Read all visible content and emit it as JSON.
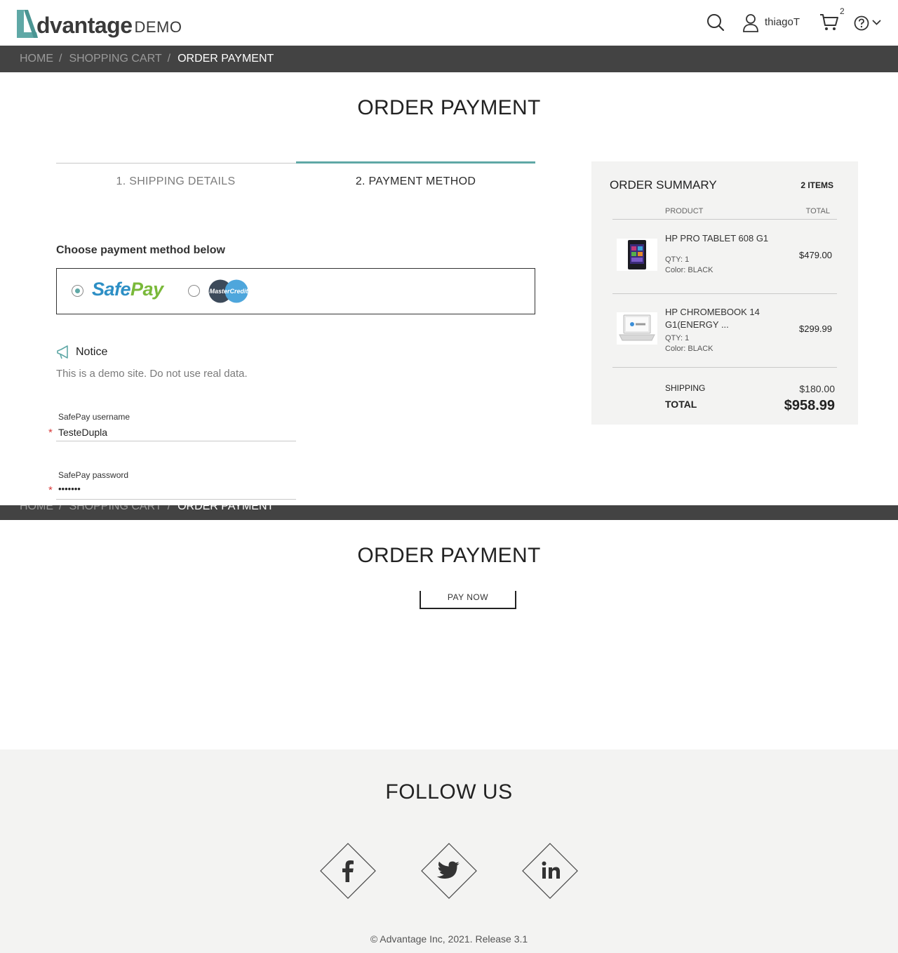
{
  "header": {
    "logo_word": "dvantage",
    "logo_demo": "DEMO",
    "user_name": "thiagoT",
    "cart_count": "2",
    "icons": [
      "search-icon",
      "user-icon",
      "cart-icon",
      "help-icon",
      "chevron-down-icon"
    ]
  },
  "breadcrumb": {
    "home": "HOME",
    "sep": "/",
    "cart": "SHOPPING CART",
    "current": "ORDER PAYMENT"
  },
  "page_title": "ORDER PAYMENT",
  "steps": [
    {
      "label": "1. SHIPPING DETAILS",
      "active": false
    },
    {
      "label": "2. PAYMENT METHOD",
      "active": true
    }
  ],
  "payment": {
    "choose_label": "Choose payment method below",
    "options": [
      {
        "name": "SafePay",
        "selected": true
      },
      {
        "name": "MasterCredit",
        "selected": false
      }
    ],
    "safepay_part1": "Safe",
    "safepay_part2": "Pay",
    "mastercredit_text": "MasterCredit"
  },
  "notice": {
    "title": "Notice",
    "text": "This is a demo site. Do not use real data."
  },
  "fields": {
    "username_label": "SafePay username",
    "username_value": "TesteDupla",
    "password_label": "SafePay password",
    "password_value": "•••••••",
    "required_mark": "*"
  },
  "summary": {
    "title": "ORDER SUMMARY",
    "items_count": "2 ITEMS",
    "col_product": "PRODUCT",
    "col_total": "TOTAL",
    "products": [
      {
        "name": "HP PRO TABLET 608 G1",
        "qty": "QTY: 1",
        "color": "Color: BLACK",
        "price": "$479.00"
      },
      {
        "name": "HP CHROMEBOOK 14 G1(ENERGY ...",
        "qty": "QTY: 1",
        "color": "Color: BLACK",
        "price": "$299.99"
      }
    ],
    "shipping_label": "SHIPPING",
    "shipping_value": "$180.00",
    "total_label": "TOTAL",
    "total_value": "$958.99"
  },
  "pay_now": "PAY NOW",
  "footer": {
    "follow": "FOLLOW US",
    "social": [
      "facebook-icon",
      "twitter-icon",
      "linkedin-icon"
    ],
    "copyright": "© Advantage Inc, 2021. Release 3.1"
  },
  "colors": {
    "accent": "#5fa8a6",
    "breadcrumb_bg": "#434343",
    "summary_bg": "#f3f3f2",
    "required": "#d83a3a"
  }
}
